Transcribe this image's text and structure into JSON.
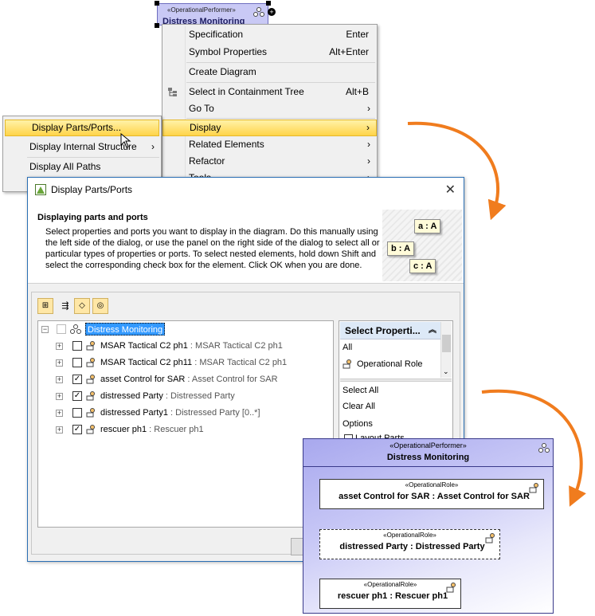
{
  "performer_symbol": {
    "stereotype": "«OperationalPerformer»",
    "name": "Distress Monitoring"
  },
  "context_menu": {
    "items": [
      {
        "label": "Specification",
        "shortcut": "Enter"
      },
      {
        "label": "Symbol Properties",
        "shortcut": "Alt+Enter"
      },
      {
        "label": "Create Diagram"
      },
      {
        "label": "Select in Containment Tree",
        "shortcut": "Alt+B"
      },
      {
        "label": "Go To"
      },
      {
        "label": "Display"
      },
      {
        "label": "Related Elements"
      },
      {
        "label": "Refactor"
      },
      {
        "label": "Tools"
      }
    ]
  },
  "display_submenu": {
    "items": [
      {
        "label": "Display Parts/Ports..."
      },
      {
        "label": "Display Internal Structure"
      },
      {
        "label": "Display All Paths"
      }
    ]
  },
  "dialog": {
    "title": "Display Parts/Ports",
    "header": "Displaying parts and ports",
    "description": "Select properties and ports you want to display in the diagram. Do this manually using the left side of the dialog, or use the panel on the right side of the dialog to select all or particular types of properties or ports. To select nested elements, hold down Shift and select the corresponding check box for the element. Click OK when you are done.",
    "illustration_tags": [
      "a : A",
      "b : A",
      "c : A"
    ],
    "tree": {
      "root": "Distress Monitoring",
      "rows": [
        {
          "name": "MSAR Tactical C2 ph1",
          "type": " : MSAR Tactical C2 ph1",
          "checked": false
        },
        {
          "name": "MSAR Tactical C2 ph11",
          "type": " : MSAR Tactical C2 ph1",
          "checked": false
        },
        {
          "name": "asset Control for SAR",
          "type": " : Asset Control for SAR",
          "checked": true
        },
        {
          "name": "distressed Party",
          "type": " : Distressed Party",
          "checked": true
        },
        {
          "name": "distressed Party1",
          "type": " : Distressed Party [0..*]",
          "checked": false
        },
        {
          "name": "rescuer ph1",
          "type": " : Rescuer ph1",
          "checked": true
        }
      ]
    },
    "select_panel": {
      "header": "Select Properti...",
      "items": [
        "All",
        "Operational Role"
      ],
      "select_all": "Select All",
      "clear_all": "Clear All",
      "options": "Options",
      "options_item": "Layout Parts"
    }
  },
  "diagram": {
    "stereotype": "«OperationalPerformer»",
    "name": "Distress Monitoring",
    "roles": [
      {
        "stereotype": "«OperationalRole»",
        "name": "asset Control for SAR : Asset Control for SAR"
      },
      {
        "stereotype": "«OperationalRole»",
        "name": "distressed Party : Distressed Party"
      },
      {
        "stereotype": "«OperationalRole»",
        "name": "rescuer ph1 : Rescuer ph1"
      }
    ]
  },
  "colors": {
    "arrow": "#f07c1e",
    "highlight": "#ffd44a",
    "selection": "#3399ff"
  }
}
